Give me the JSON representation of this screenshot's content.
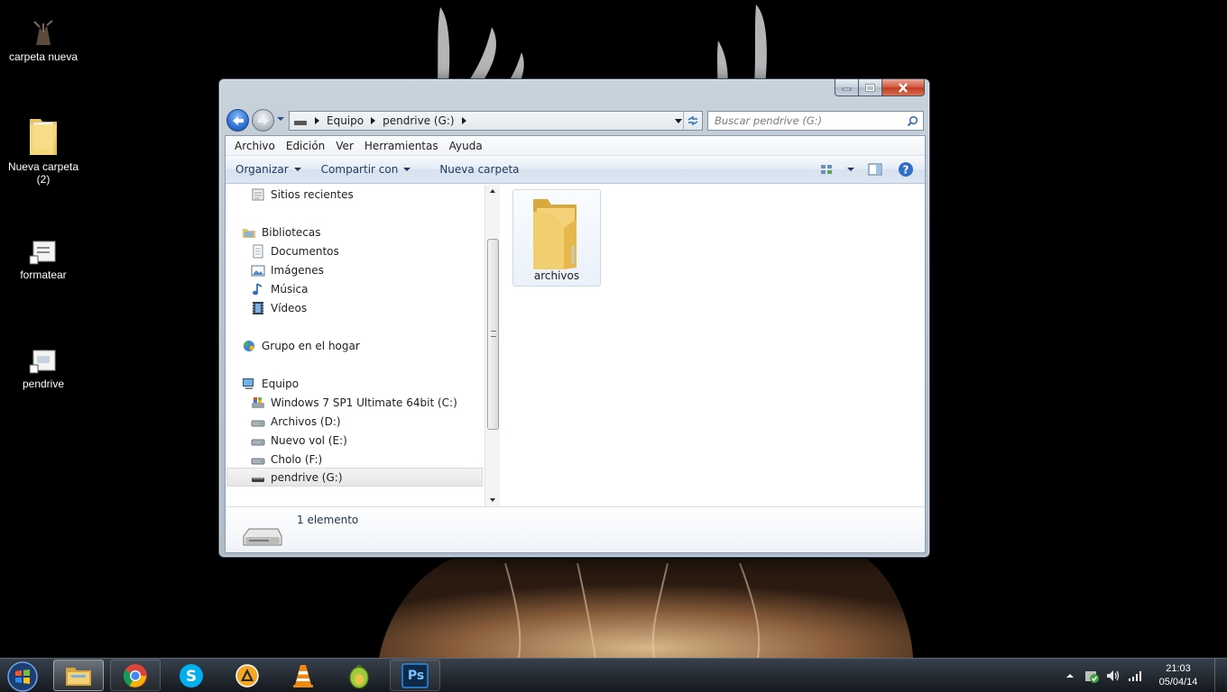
{
  "desktop": {
    "icons": [
      {
        "label": "carpeta nueva"
      },
      {
        "label": "Nueva carpeta (2)"
      },
      {
        "label": "formatear"
      },
      {
        "label": "pendrive"
      }
    ]
  },
  "window": {
    "address": {
      "crumbs": [
        "Equipo",
        "pendrive (G:)"
      ]
    },
    "search": {
      "placeholder": "Buscar pendrive (G:)"
    },
    "menu": [
      "Archivo",
      "Edición",
      "Ver",
      "Herramientas",
      "Ayuda"
    ],
    "commands": {
      "organize": "Organizar",
      "share": "Compartir con",
      "new_folder": "Nueva carpeta"
    },
    "nav": {
      "recent": "Sitios recientes",
      "libraries": "Bibliotecas",
      "library_items": [
        "Documentos",
        "Imágenes",
        "Música",
        "Vídeos"
      ],
      "homegroup": "Grupo en el hogar",
      "computer": "Equipo",
      "drives": [
        "Windows 7 SP1 Ultimate 64bit (C:)",
        "Archivos (D:)",
        "Nuevo vol (E:)",
        "Cholo (F:)",
        "pendrive (G:)"
      ],
      "selected": "pendrive (G:)"
    },
    "content": {
      "items": [
        {
          "name": "archivos",
          "icon": "folder-icon"
        }
      ]
    },
    "details": {
      "count": "1 elemento"
    }
  },
  "taskbar": {
    "apps": [
      "windows-explorer-icon",
      "chrome-icon",
      "skype-icon",
      "aimp-icon",
      "vlc-icon",
      "egg-app-icon",
      "photoshop-icon"
    ],
    "photoshop_label": "Ps",
    "clock": {
      "time": "21:03",
      "date": "05/04/14"
    }
  },
  "colors": {
    "taskbar": "#1c2129",
    "accent": "#2d6fd0",
    "close": "#c03a1e"
  }
}
